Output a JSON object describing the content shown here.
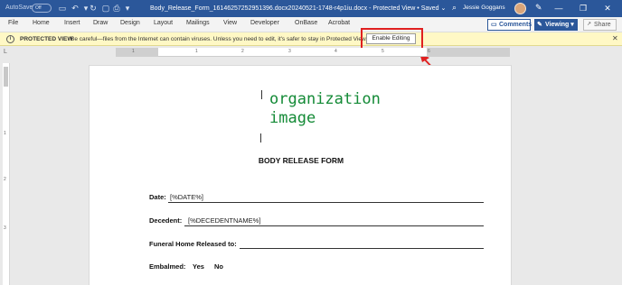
{
  "titlebar": {
    "autosave_label": "AutoSave",
    "autosave_state": "Off",
    "document_title": "Body_Release_Form_16146257252951396.docx20240521-1748-r4p1iu.docx",
    "mode": "Protected View",
    "save_state": "Saved",
    "user_name": "Jessie Goggans"
  },
  "menu": {
    "tabs": [
      "File",
      "Home",
      "Insert",
      "Draw",
      "Design",
      "Layout",
      "Mailings",
      "View",
      "Developer",
      "OnBase",
      "Acrobat"
    ],
    "comments_label": "Comments",
    "viewing_label": "Viewing",
    "share_label": "Share"
  },
  "protected_view": {
    "label": "PROTECTED VIEW",
    "message": "Be careful—files from the Internet can contain viruses. Unless you need to edit, it's safer to stay in Protected View.",
    "enable_button": "Enable Editing"
  },
  "ruler": {
    "numbers": [
      "1",
      "1",
      "2",
      "3",
      "4",
      "5",
      "6"
    ]
  },
  "vruler": {
    "numbers": [
      "1",
      "2",
      "3"
    ]
  },
  "document": {
    "image_placeholder_line1": "organization",
    "image_placeholder_line2": "image",
    "form_title": "BODY RELEASE FORM",
    "date_label": "Date:",
    "date_value": "[%DATE%]",
    "decedent_label": "Decedent:",
    "decedent_value": "[%DECEDENTNAME%]",
    "funeral_home_label": "Funeral Home Released to:",
    "embalmed_label": "Embalmed:",
    "embalmed_yes": "Yes",
    "embalmed_no": "No"
  },
  "colors": {
    "titlebar": "#2b579a",
    "protected_bar": "#fff8c5",
    "annotation": "#e02020",
    "image_placeholder": "#138a36"
  }
}
